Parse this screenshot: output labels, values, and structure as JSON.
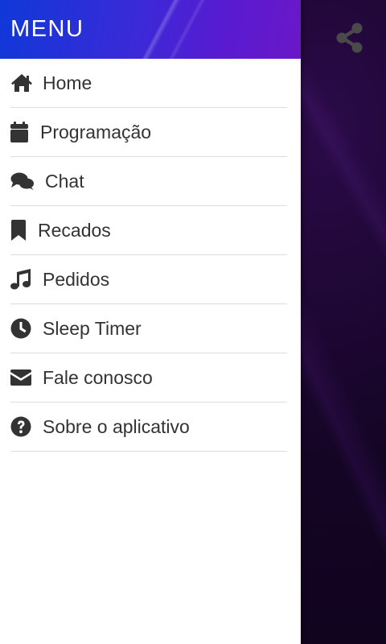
{
  "drawer": {
    "title": "MENU",
    "items": [
      {
        "label": "Home",
        "icon": "home-icon"
      },
      {
        "label": "Programação",
        "icon": "calendar-icon"
      },
      {
        "label": "Chat",
        "icon": "chat-icon"
      },
      {
        "label": "Recados",
        "icon": "bookmark-icon"
      },
      {
        "label": "Pedidos",
        "icon": "music-note-icon"
      },
      {
        "label": "Sleep Timer",
        "icon": "clock-icon"
      },
      {
        "label": "Fale conosco",
        "icon": "envelope-icon"
      },
      {
        "label": "Sobre o aplicativo",
        "icon": "question-circle-icon"
      }
    ]
  },
  "app": {
    "share_icon": "share-icon"
  },
  "colors": {
    "header_gradient_start": "#1038d8",
    "header_gradient_end": "#6a18c8",
    "background": "#14061f",
    "text": "#333333",
    "divider": "#dddddd"
  }
}
